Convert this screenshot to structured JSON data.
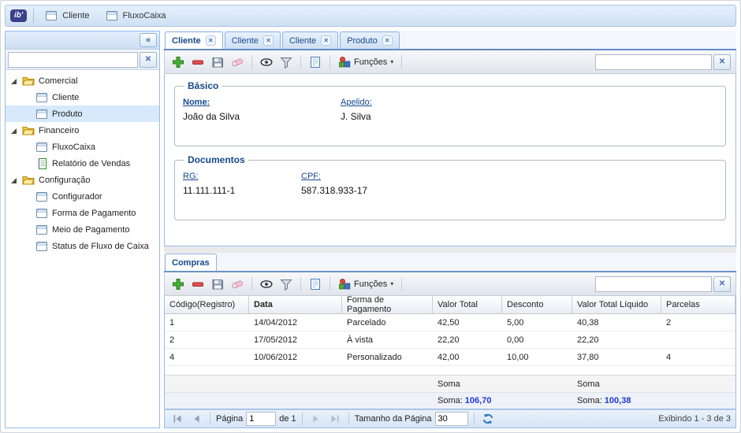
{
  "icons": {
    "close": "✕",
    "collapse": "«",
    "clear": "✕",
    "dropdown": "▾"
  },
  "header": {
    "logo": "ib'",
    "buttons": [
      {
        "label": "Cliente"
      },
      {
        "label": "FluxoCaixa"
      }
    ]
  },
  "sidebar": {
    "search_value": "",
    "tree": [
      {
        "label": "Comercial"
      },
      {
        "label": "Cliente"
      },
      {
        "label": "Produto"
      },
      {
        "label": "Financeiro"
      },
      {
        "label": "FluxoCaixa"
      },
      {
        "label": "Relatório de Vendas"
      },
      {
        "label": "Configuração"
      },
      {
        "label": "Configurador"
      },
      {
        "label": "Forma de Pagamento"
      },
      {
        "label": "Meio de Pagamento"
      },
      {
        "label": "Status de Fluxo de Caixa"
      }
    ]
  },
  "main": {
    "tabs": [
      {
        "label": "Cliente"
      },
      {
        "label": "Cliente"
      },
      {
        "label": "Cliente"
      },
      {
        "label": "Produto"
      }
    ],
    "toolbar": {
      "funcoes": "Funções",
      "search_value": ""
    },
    "form": {
      "basico": {
        "legend": "Básico",
        "fields": [
          {
            "label": "Nome:",
            "value": "João da Silva"
          },
          {
            "label": "Apelido:",
            "value": "J. Silva"
          }
        ]
      },
      "documentos": {
        "legend": "Documentos",
        "fields": [
          {
            "label": "RG:",
            "value": "11.111.111-1"
          },
          {
            "label": "CPF:",
            "value": "587.318.933-17"
          }
        ]
      }
    }
  },
  "compras": {
    "tab": "Compras",
    "toolbar": {
      "funcoes": "Funções",
      "search_value": ""
    },
    "grid": {
      "columns": [
        "Código(Registro)",
        "Data",
        "Forma de Pagamento",
        "Valor Total",
        "Desconto",
        "Valor Total Líquido",
        "Parcelas"
      ],
      "rows": [
        [
          "1",
          "14/04/2012",
          "Parcelado",
          "42,50",
          "5,00",
          "40,38",
          "2"
        ],
        [
          "2",
          "17/05/2012",
          "À vista",
          "22,20",
          "0,00",
          "22,20",
          ""
        ],
        [
          "4",
          "10/06/2012",
          "Personalizado",
          "42,00",
          "10,00",
          "37,80",
          "4"
        ]
      ],
      "summary_top": {
        "valor_total": "Soma",
        "valor_liquido": "Soma"
      },
      "summary_bottom": {
        "valor_total_label": "Soma:",
        "valor_total_value": "106,70",
        "valor_liquido_label": "Soma:",
        "valor_liquido_value": "100,38"
      }
    },
    "paging": {
      "pagina": "Página",
      "page": "1",
      "de": "de 1",
      "tamanho": "Tamanho da Página",
      "size": "30",
      "display": "Exibindo 1 - 3 de 3"
    }
  }
}
